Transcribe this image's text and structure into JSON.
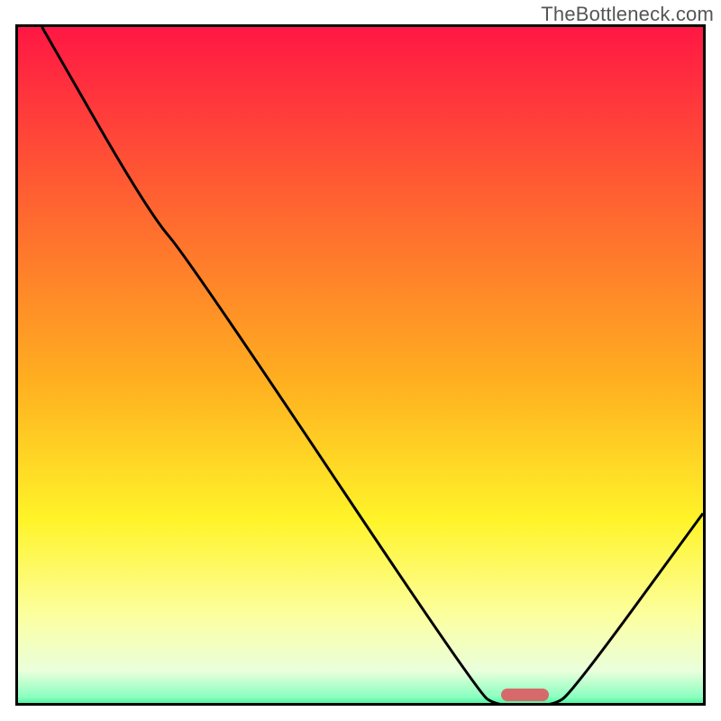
{
  "watermark_text": "TheBottleneck.com",
  "colors": {
    "frame_border": "#000000",
    "curve_stroke": "#000000",
    "marker_fill": "#d66a6a",
    "watermark": "#555555"
  },
  "chart_data": {
    "type": "line",
    "title": "",
    "xlabel": "",
    "ylabel": "",
    "xlim": [
      0,
      100
    ],
    "ylim": [
      0,
      100
    ],
    "gradient_stops": [
      {
        "offset": 0.0,
        "color": "#ff1744"
      },
      {
        "offset": 0.28,
        "color": "#ff6a2f"
      },
      {
        "offset": 0.52,
        "color": "#ffb020"
      },
      {
        "offset": 0.72,
        "color": "#fff429"
      },
      {
        "offset": 0.86,
        "color": "#fcffa0"
      },
      {
        "offset": 0.94,
        "color": "#eaffdc"
      },
      {
        "offset": 0.978,
        "color": "#8affc0"
      },
      {
        "offset": 1.0,
        "color": "#00e676"
      }
    ],
    "curve_points": [
      {
        "x": 3.5,
        "y": 100.0
      },
      {
        "x": 19.0,
        "y": 73.0
      },
      {
        "x": 25.0,
        "y": 66.0
      },
      {
        "x": 67.0,
        "y": 3.0
      },
      {
        "x": 70.0,
        "y": 0.8
      },
      {
        "x": 78.0,
        "y": 0.8
      },
      {
        "x": 81.0,
        "y": 3.0
      },
      {
        "x": 100.0,
        "y": 29.0
      }
    ],
    "optimum_marker": {
      "x_start": 70.5,
      "x_end": 77.5,
      "y": 1.2,
      "thickness_pct": 1.8
    }
  }
}
